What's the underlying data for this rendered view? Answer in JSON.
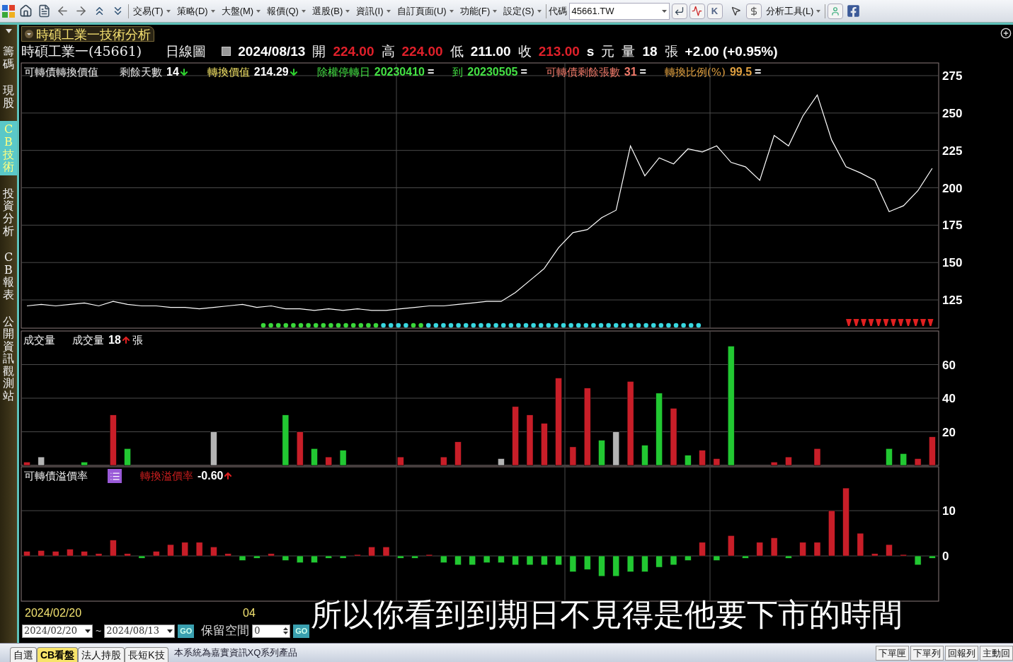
{
  "toolbar": {
    "menus": [
      {
        "label": "交易(T)"
      },
      {
        "label": "策略(D)"
      },
      {
        "label": "大盤(M)"
      },
      {
        "label": "報價(Q)"
      },
      {
        "label": "選股(B)"
      },
      {
        "label": "資訊(I)"
      },
      {
        "label": "自訂頁面(U)"
      },
      {
        "label": "功能(F)"
      },
      {
        "label": "設定(S)"
      }
    ],
    "code_label": "代碼",
    "code_value": "45661.TW",
    "k_button": "K",
    "tools_menu": "分析工具(L)"
  },
  "sidebar": {
    "tabs": [
      {
        "label": "籌碼",
        "selected": false
      },
      {
        "label": "現股",
        "selected": false
      },
      {
        "label": "CB技術",
        "selected": true
      },
      {
        "label": "投資分析",
        "selected": false
      },
      {
        "label": "CB報表",
        "selected": false
      },
      {
        "label": "公開資訊觀測站",
        "selected": false
      }
    ]
  },
  "window": {
    "title": "時碩工業一技術分析"
  },
  "quote": [
    {
      "text": "時碩工業一(45661)",
      "bold": false,
      "color": "#f0f0f0"
    },
    {
      "text": "日線圖",
      "bold": false,
      "color": "#f0f0f0"
    },
    {
      "text": "2024/08/13",
      "bold": true,
      "color": "#ffffff"
    },
    {
      "text": "開",
      "bold": false,
      "color": "#f0f0f0"
    },
    {
      "text": "224.00",
      "bold": true,
      "color": "#e0202a"
    },
    {
      "text": "高",
      "bold": false,
      "color": "#f0f0f0"
    },
    {
      "text": "224.00",
      "bold": true,
      "color": "#e0202a"
    },
    {
      "text": "低",
      "bold": false,
      "color": "#f0f0f0"
    },
    {
      "text": "211.00",
      "bold": true,
      "color": "#ffffff"
    },
    {
      "text": "收",
      "bold": false,
      "color": "#f0f0f0"
    },
    {
      "text": "213.00",
      "bold": true,
      "color": "#e0202a"
    },
    {
      "text": "s",
      "bold": true,
      "color": "#ffffff"
    },
    {
      "text": "元",
      "bold": false,
      "color": "#f0f0f0"
    },
    {
      "text": "量",
      "bold": false,
      "color": "#f0f0f0"
    },
    {
      "text": "18",
      "bold": true,
      "color": "#ffffff"
    },
    {
      "text": "張",
      "bold": false,
      "color": "#f0f0f0"
    },
    {
      "text": "+2.00 (+0.95%)",
      "bold": true,
      "color": "#ffffff"
    }
  ],
  "price_panel": {
    "title": "可轉債轉換價值",
    "indicators": [
      {
        "label": "剩餘天數",
        "value": "14",
        "kind": "down",
        "color": "#e6e6e6"
      },
      {
        "label": "轉換價值",
        "value": "214.29",
        "kind": "down",
        "color": "#f2e266"
      },
      {
        "label": "除權停轉日",
        "value": "20230410",
        "suffix": "=",
        "color": "#44e044"
      },
      {
        "label": "到",
        "value": "20230505",
        "suffix": "=",
        "color": "#44e044"
      },
      {
        "label": "可轉債剩餘張數",
        "value": "31",
        "suffix": "=",
        "color": "#f07a6a"
      },
      {
        "label": "轉換比例(%)",
        "value": "99.5",
        "suffix": "=",
        "color": "#e0a040"
      }
    ],
    "chart_data": {
      "type": "line",
      "grid": true,
      "ylim": [
        106.1,
        283.5
      ],
      "yticks": [
        125,
        150,
        175,
        200,
        225,
        250,
        275
      ],
      "series": [
        {
          "color": "#ffffff",
          "values": [
            121,
            122,
            121,
            122,
            123,
            121,
            124,
            122,
            121,
            121,
            120,
            120,
            119,
            120,
            121,
            122,
            120,
            121,
            119,
            119,
            118,
            119,
            118,
            119,
            118,
            118,
            119,
            120,
            121,
            121,
            122,
            123,
            124,
            124,
            130,
            138,
            146,
            160,
            170,
            172,
            180,
            185,
            228,
            208,
            220,
            216,
            226,
            224,
            228,
            217,
            214,
            205,
            235,
            228,
            248,
            262,
            232,
            214,
            210,
            205,
            184,
            188,
            198,
            213
          ]
        }
      ]
    }
  },
  "volume_panel": {
    "title": "成交量",
    "indicator": {
      "label": "成交量",
      "value": "18",
      "kind": "up",
      "unit": "張"
    },
    "chart_data": {
      "type": "bar",
      "grid": true,
      "stacked": true,
      "ylim": [
        0,
        80
      ],
      "yticks": [
        20,
        40,
        60
      ],
      "series": [
        {
          "color": "#c81e28",
          "values": [
            2,
            null,
            null,
            null,
            null,
            null,
            30,
            null,
            null,
            null,
            null,
            null,
            null,
            null,
            null,
            null,
            null,
            null,
            null,
            20,
            null,
            5,
            null,
            null,
            null,
            null,
            5,
            null,
            null,
            5,
            14,
            null,
            null,
            null,
            35,
            30,
            25,
            52,
            11,
            46,
            null,
            null,
            50,
            null,
            null,
            34,
            null,
            9,
            4,
            null,
            null,
            null,
            2,
            5,
            null,
            10,
            null,
            null,
            null,
            null,
            null,
            null,
            4,
            17
          ]
        },
        {
          "color": "#22c832",
          "values": [
            null,
            null,
            null,
            null,
            2,
            null,
            null,
            10,
            null,
            null,
            null,
            null,
            null,
            null,
            null,
            null,
            null,
            null,
            30,
            null,
            10,
            null,
            9,
            null,
            null,
            null,
            null,
            null,
            null,
            null,
            null,
            null,
            null,
            null,
            null,
            null,
            null,
            null,
            null,
            null,
            15,
            null,
            null,
            12,
            43,
            null,
            6,
            null,
            null,
            71,
            null,
            null,
            null,
            null,
            null,
            null,
            null,
            null,
            null,
            null,
            10,
            7,
            null,
            null
          ]
        },
        {
          "color": "#b4b4b4",
          "values": [
            null,
            5,
            null,
            null,
            null,
            null,
            null,
            null,
            null,
            null,
            null,
            null,
            null,
            20,
            null,
            null,
            null,
            null,
            null,
            null,
            null,
            null,
            null,
            null,
            null,
            null,
            null,
            null,
            null,
            null,
            null,
            null,
            null,
            4,
            null,
            null,
            null,
            null,
            null,
            null,
            null,
            20,
            null,
            null,
            null,
            null,
            null,
            null,
            null,
            null,
            null,
            null,
            null,
            null,
            null,
            null,
            null,
            null,
            null,
            null,
            null,
            null,
            null,
            null
          ]
        }
      ]
    }
  },
  "premium_panel": {
    "title": "可轉債溢價率",
    "indicator": {
      "label": "轉換溢價率",
      "value": "-0.60",
      "kind": "up",
      "color": "#d01f1f"
    },
    "chart_data": {
      "type": "bar",
      "grid": true,
      "stacked": true,
      "ylim": [
        -10,
        19.7
      ],
      "yticks": [
        0,
        10
      ],
      "series": [
        {
          "color": "#c81e28",
          "values": [
            1,
            1.2,
            1,
            1.5,
            1,
            0.5,
            3.5,
            0.5,
            null,
            1,
            2.5,
            3,
            3,
            2,
            0.5,
            null,
            null,
            0.5,
            null,
            null,
            null,
            null,
            null,
            0.3,
            2,
            2,
            null,
            null,
            0.3,
            null,
            null,
            null,
            null,
            null,
            null,
            null,
            null,
            null,
            null,
            null,
            null,
            null,
            null,
            null,
            null,
            null,
            null,
            3,
            null,
            4.5,
            null,
            3,
            4,
            null,
            3,
            3,
            10,
            15,
            5,
            0.5,
            2.5,
            0.3,
            null,
            null
          ]
        },
        {
          "color": "#22c832",
          "values": [
            null,
            null,
            null,
            null,
            null,
            null,
            null,
            null,
            -0.5,
            null,
            null,
            null,
            null,
            null,
            null,
            -1,
            -0.5,
            null,
            -1,
            -1.5,
            -1.5,
            -0.5,
            -0.5,
            null,
            null,
            null,
            -0.5,
            -0.5,
            null,
            -1.5,
            -2,
            -2,
            -1.5,
            -1.5,
            -2,
            -2,
            -2,
            -2,
            -3.5,
            -3,
            -4.5,
            -4.5,
            -3.5,
            -3.5,
            -2.5,
            -2,
            -1,
            null,
            -1,
            null,
            -0.5,
            null,
            null,
            -0.5,
            null,
            null,
            null,
            null,
            null,
            null,
            null,
            null,
            -2,
            -0.5
          ]
        }
      ]
    }
  },
  "date_axis": [
    "2024/02/20",
    "04"
  ],
  "date_range": {
    "start": "2024/02/20",
    "separator": "~",
    "end": "2024/08/13",
    "go": "GO",
    "reserve_label": "保留空間",
    "reserve_value": "0",
    "reserve_go": "GO"
  },
  "subtitle": "所以你看到到期日不見得是他要下市的時間",
  "bottom_tabs": [
    {
      "label": "自選",
      "selected": false
    },
    {
      "label": "CB看盤",
      "selected": true
    },
    {
      "label": "法人持股",
      "selected": false
    },
    {
      "label": "長短K技",
      "selected": false
    }
  ],
  "status_text": "本系統為嘉實資訊XQ系列產品",
  "bottom_buttons": [
    {
      "label": "下單匣"
    },
    {
      "label": "下單列"
    },
    {
      "label": "回報列"
    },
    {
      "label": "主動回"
    }
  ]
}
